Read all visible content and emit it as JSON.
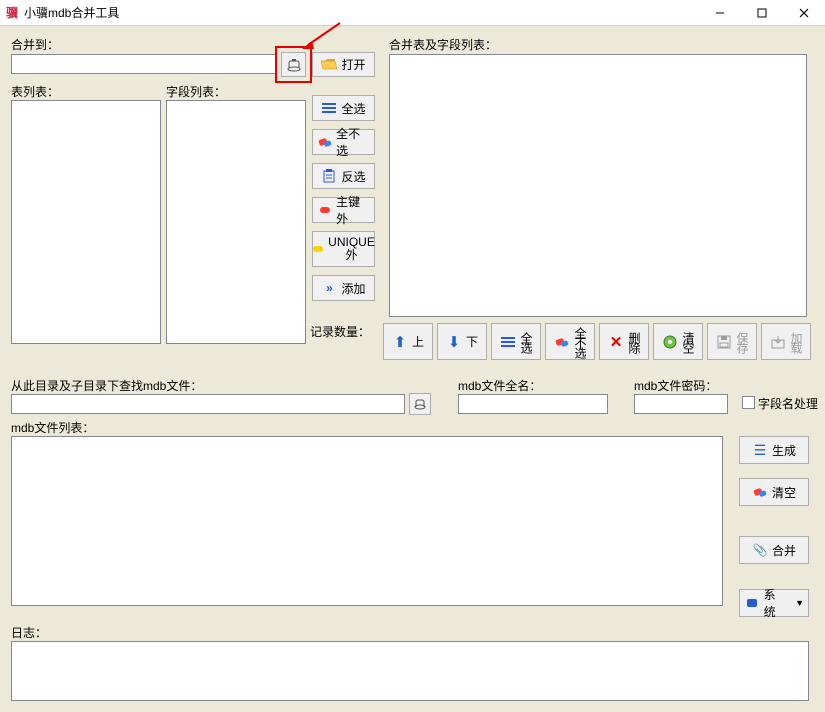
{
  "window": {
    "title": "小骥mdb合并工具",
    "icon_label": "骥"
  },
  "top": {
    "merge_to_label": "合并到：",
    "merge_to_value": "",
    "browse_tooltip": "浏览",
    "open_label": "打开",
    "tables_label": "表列表：",
    "fields_label": "字段列表：",
    "merge_tables_fields_label": "合并表及字段列表：",
    "record_count_label": "记录数量："
  },
  "side_buttons": {
    "select_all": "全选",
    "select_none": "全不选",
    "invert": "反选",
    "pk_outside": "主键外",
    "unique_outside_line1": "UNIQUE",
    "unique_outside_line2": "外",
    "add": "添加"
  },
  "toolbar": {
    "up": "上",
    "down": "下",
    "select_all": "全选",
    "select_none": "全不选",
    "delete": "删除",
    "clear": "清空",
    "save": "保存",
    "load": "加载"
  },
  "middle": {
    "search_label": "从此目录及子目录下查找mdb文件：",
    "search_value": "",
    "fullname_label": "mdb文件全名：",
    "fullname_value": "",
    "password_label": "mdb文件密码：",
    "password_value": "",
    "fieldname_proc_label": "字段名处理",
    "filelist_label": "mdb文件列表："
  },
  "right_buttons": {
    "generate": "生成",
    "clear": "清空",
    "merge": "合并",
    "system": "系统"
  },
  "log": {
    "label": "日志："
  }
}
